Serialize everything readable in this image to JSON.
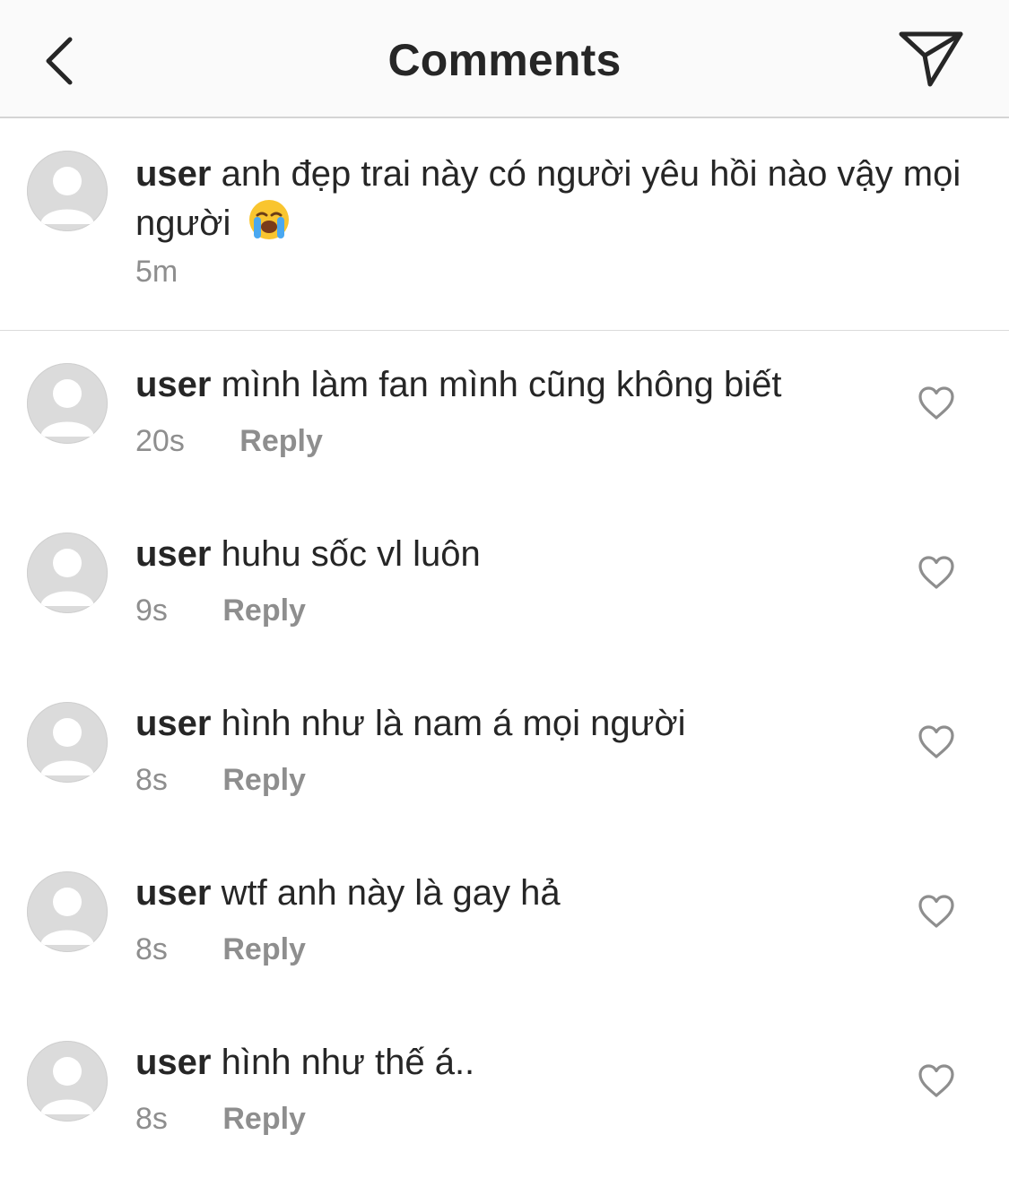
{
  "header": {
    "title": "Comments",
    "back_icon": "chevron-left-icon",
    "send_icon": "paper-plane-icon"
  },
  "caption": {
    "username": "user",
    "text": "anh đẹp trai này có người yêu hồi nào vậy mọi người",
    "emoji": "loudly-crying-face",
    "time": "5m"
  },
  "comments": [
    {
      "username": "user",
      "text": "mình làm fan mình cũng không biết",
      "time": "20s",
      "reply_label": "Reply"
    },
    {
      "username": "user",
      "text": "huhu sốc vl luôn",
      "time": "9s",
      "reply_label": "Reply"
    },
    {
      "username": "user",
      "text": "hình như là nam á mọi người",
      "time": "8s",
      "reply_label": "Reply"
    },
    {
      "username": "user",
      "text": "wtf anh này là gay hả",
      "time": "8s",
      "reply_label": "Reply"
    },
    {
      "username": "user",
      "text": "hình như thế á..",
      "time": "8s",
      "reply_label": "Reply"
    }
  ],
  "colors": {
    "text": "#262626",
    "secondary": "#8e8e8e",
    "avatar_bg": "#dbdbdb",
    "header_bg": "#fafafa"
  }
}
